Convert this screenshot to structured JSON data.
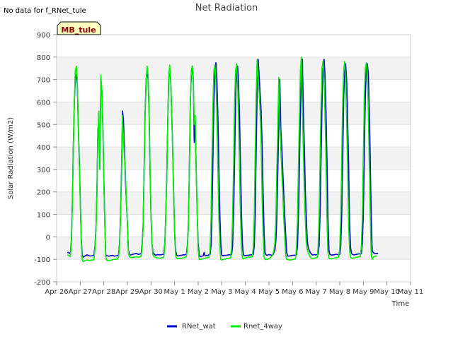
{
  "header": {
    "no_data_note": "No data for f_RNet_tule",
    "site_tag": "MB_tule"
  },
  "chart_data": {
    "type": "line",
    "title": "Net Radiation",
    "xlabel": "Time",
    "ylabel": "Solar Radiation (W/m2)",
    "ylim": [
      -200,
      900
    ],
    "yticks": [
      -200,
      -100,
      0,
      100,
      200,
      300,
      400,
      500,
      600,
      700,
      800,
      900
    ],
    "x_tick_labels": [
      "Apr 26",
      "Apr 27",
      "Apr 28",
      "Apr 29",
      "Apr 30",
      "May 1",
      "May 2",
      "May 3",
      "May 4",
      "May 5",
      "May 6",
      "May 7",
      "May 8",
      "May 9",
      "May 10",
      "May 11"
    ],
    "grid": "horizontal bands",
    "legend_position": "bottom-center",
    "series": [
      {
        "name": "RNet_wat",
        "color": "#0000cc",
        "x_start": "2023-04-26T11:00",
        "step_hours": 1,
        "values": [
          -70,
          -70,
          -72,
          -75,
          -20,
          150,
          400,
          600,
          700,
          720,
          680,
          500,
          360,
          180,
          0,
          -80,
          -90,
          -88,
          -85,
          -82,
          -80,
          -82,
          -84,
          -85,
          -85,
          -84,
          -83,
          -82,
          -40,
          40,
          200,
          480,
          500,
          300,
          700,
          650,
          500,
          260,
          60,
          -80,
          -85,
          -84,
          -86,
          -85,
          -84,
          -83,
          -82,
          -85,
          -86,
          -85,
          -84,
          -84,
          -80,
          -30,
          100,
          300,
          560,
          520,
          400,
          250,
          150,
          60,
          -60,
          -78,
          -80,
          -80,
          -78,
          -77,
          -76,
          -75,
          -74,
          -76,
          -78,
          -77,
          -76,
          -75,
          -30,
          50,
          300,
          550,
          700,
          740,
          700,
          560,
          310,
          100,
          -30,
          -70,
          -75,
          -80,
          -82,
          -80,
          -79,
          -80,
          -80,
          -80,
          -79,
          -78,
          -77,
          -30,
          100,
          270,
          500,
          700,
          740,
          700,
          560,
          400,
          200,
          20,
          -60,
          -80,
          -85,
          -84,
          -83,
          -82,
          -82,
          -81,
          -80,
          -80,
          -79,
          -78,
          -40,
          50,
          300,
          600,
          720,
          760,
          700,
          420,
          520,
          300,
          100,
          -30,
          -80,
          -88,
          -87,
          -86,
          -85,
          -70,
          -84,
          -83,
          -82,
          -82,
          -80,
          -79,
          -40,
          80,
          350,
          600,
          740,
          775,
          700,
          540,
          320,
          100,
          -30,
          -80,
          -84,
          -83,
          -82,
          -82,
          -82,
          -81,
          -80,
          -80,
          -80,
          -79,
          -40,
          100,
          330,
          600,
          740,
          760,
          700,
          550,
          330,
          110,
          -30,
          -80,
          -84,
          -84,
          -83,
          -82,
          -82,
          -81,
          -80,
          -80,
          -80,
          -79,
          -40,
          100,
          380,
          650,
          790,
          720,
          640,
          560,
          420,
          200,
          20,
          -70,
          -80,
          -82,
          -80,
          -79,
          -80,
          -81,
          -82,
          -80,
          -70,
          -60,
          -20,
          80,
          300,
          500,
          700,
          480,
          400,
          300,
          200,
          100,
          10,
          -70,
          -85,
          -86,
          -85,
          -84,
          -83,
          -82,
          -82,
          -82,
          -81,
          -80,
          -40,
          100,
          330,
          550,
          740,
          790,
          560,
          400,
          200,
          80,
          -20,
          -50,
          -60,
          -70,
          -75,
          -80,
          -80,
          -79,
          -80,
          -80,
          -79,
          -78,
          -40,
          100,
          350,
          600,
          760,
          790,
          720,
          550,
          350,
          90,
          -60,
          -78,
          -80,
          -81,
          -80,
          -80,
          -79,
          -78,
          -78,
          -79,
          -80,
          -78,
          -40,
          100,
          360,
          620,
          740,
          770,
          700,
          530,
          320,
          60,
          -50,
          -75,
          -78,
          -80,
          -80,
          -79,
          -78,
          -77,
          -76,
          -76,
          -75,
          -74,
          -30,
          100,
          370,
          620,
          750,
          770,
          730,
          580,
          340,
          100,
          -60,
          -70,
          -72,
          -74,
          -75,
          -74,
          -73
        ]
      },
      {
        "name": "Rnet_4way",
        "color": "#00ee00",
        "x_start": "2023-04-26T11:00",
        "step_hours": 1,
        "values": [
          -80,
          -82,
          -85,
          -88,
          -30,
          140,
          390,
          600,
          740,
          760,
          700,
          480,
          340,
          160,
          -10,
          -100,
          -110,
          -108,
          -106,
          -104,
          -103,
          -104,
          -105,
          -105,
          -104,
          -103,
          -103,
          -102,
          -50,
          30,
          180,
          460,
          560,
          300,
          720,
          650,
          480,
          250,
          50,
          -90,
          -105,
          -104,
          -106,
          -105,
          -104,
          -103,
          -102,
          -100,
          -100,
          -100,
          -99,
          -98,
          -90,
          -40,
          90,
          280,
          540,
          430,
          360,
          290,
          150,
          60,
          -70,
          -88,
          -92,
          -92,
          -92,
          -91,
          -90,
          -90,
          -89,
          -90,
          -90,
          -90,
          -88,
          -87,
          -40,
          40,
          290,
          540,
          690,
          760,
          720,
          560,
          320,
          100,
          -30,
          -80,
          -88,
          -90,
          -92,
          -93,
          -94,
          -95,
          -95,
          -94,
          -93,
          -92,
          -91,
          -40,
          90,
          260,
          500,
          700,
          765,
          700,
          560,
          380,
          190,
          10,
          -80,
          -95,
          -98,
          -97,
          -96,
          -95,
          -95,
          -94,
          -93,
          -92,
          -90,
          -88,
          -50,
          40,
          290,
          600,
          740,
          760,
          700,
          500,
          540,
          280,
          100,
          -60,
          -100,
          -101,
          -100,
          -99,
          -98,
          -96,
          -95,
          -94,
          -93,
          -92,
          -91,
          -60,
          70,
          340,
          590,
          740,
          765,
          700,
          530,
          310,
          90,
          -40,
          -100,
          -103,
          -102,
          -100,
          -99,
          -98,
          -97,
          -96,
          -95,
          -94,
          -93,
          -50,
          90,
          320,
          600,
          740,
          770,
          700,
          540,
          320,
          100,
          -40,
          -95,
          -98,
          -96,
          -94,
          -93,
          -92,
          -91,
          -90,
          -90,
          -89,
          -88,
          -50,
          90,
          370,
          640,
          790,
          700,
          640,
          560,
          420,
          180,
          10,
          -90,
          -100,
          -101,
          -100,
          -99,
          -96,
          -94,
          -90,
          -85,
          -75,
          -60,
          -30,
          70,
          290,
          500,
          710,
          520,
          400,
          290,
          200,
          90,
          0,
          -80,
          -100,
          -101,
          -102,
          -103,
          -103,
          -102,
          -101,
          -100,
          -99,
          -98,
          -50,
          90,
          320,
          550,
          740,
          800,
          570,
          380,
          190,
          70,
          -30,
          -60,
          -70,
          -80,
          -90,
          -95,
          -96,
          -95,
          -95,
          -94,
          -93,
          -92,
          -50,
          90,
          340,
          590,
          750,
          780,
          720,
          540,
          340,
          80,
          -70,
          -95,
          -97,
          -98,
          -98,
          -96,
          -95,
          -94,
          -93,
          -92,
          -92,
          -91,
          -50,
          90,
          350,
          610,
          740,
          780,
          700,
          520,
          310,
          50,
          -60,
          -92,
          -95,
          -95,
          -94,
          -93,
          -92,
          -91,
          -90,
          -89,
          -88,
          -87,
          -40,
          90,
          360,
          620,
          750,
          775,
          730,
          570,
          330,
          90,
          -80,
          -100,
          -90,
          -88,
          -87,
          -86,
          -85
        ]
      }
    ]
  }
}
